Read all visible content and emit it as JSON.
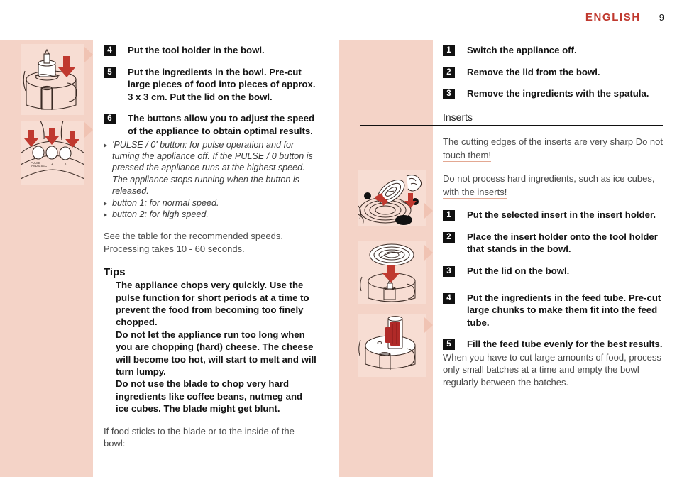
{
  "header": {
    "language": "ENGLISH",
    "page_number": "9"
  },
  "left_column": {
    "steps": [
      {
        "number": "4",
        "text": "Put the tool holder in the bowl."
      },
      {
        "number": "5",
        "text": "Put the ingredients in the bowl. Pre-cut large pieces of food into pieces of approx. 3 x 3 cm. Put the lid on the bowl."
      },
      {
        "number": "6",
        "text": "The buttons allow you to adjust the speed of the appliance to obtain optimal results."
      }
    ],
    "bullets": [
      "'PULSE / 0' button: for pulse operation and for turning the appliance off. If the PULSE / 0 button is pressed the appliance runs at the highest speed. The appliance stops running when the button is released.",
      "button 1: for normal speed.",
      "button 2: for high speed."
    ],
    "speeds_note": "See the table for the recommended speeds. Processing takes 10 - 60 seconds.",
    "tips_heading": "Tips",
    "tips": [
      "The appliance chops very quickly. Use the pulse function for short periods at a time to prevent the food from becoming too finely chopped.",
      "Do not let the appliance run too long when you are chopping (hard) cheese. The cheese will become too hot, will start to melt and will turn lumpy.",
      "Do not use the blade to chop very hard ingredients like coffee beans, nutmeg and ice cubes. The blade might get blunt."
    ],
    "closing_note": "If food sticks to the blade or to the inside of the bowl:"
  },
  "right_column": {
    "steps_top": [
      {
        "number": "1",
        "text": "Switch the appliance off."
      },
      {
        "number": "2",
        "text": "Remove the lid from the bowl."
      },
      {
        "number": "3",
        "text": "Remove the ingredients with the spatula."
      }
    ],
    "section_heading": "Inserts",
    "warnings": [
      "The cutting edges of the inserts are very sharp Do not touch them!",
      "Do not process hard ingredients, such as ice cubes, with the inserts!"
    ],
    "steps_bottom": [
      {
        "number": "1",
        "text": "Put the selected insert in the insert holder."
      },
      {
        "number": "2",
        "text": "Place the insert holder onto the tool holder that stands in the bowl."
      },
      {
        "number": "3",
        "text": "Put the lid on the bowl."
      },
      {
        "number": "4",
        "text": "Put the ingredients in the feed tube. Pre-cut large chunks to make them fit into the feed tube."
      },
      {
        "number": "5",
        "text": "Fill the feed tube evenly for the best results."
      }
    ],
    "closing_note": "When you have to cut large amounts of food, process only small batches at a time and empty the bowl regularly between the batches."
  },
  "illustrations": [
    {
      "name": "tool-holder-in-bowl"
    },
    {
      "name": "control-buttons-pulse-one-two"
    },
    {
      "name": "hand-holding-insert-warning"
    },
    {
      "name": "insert-holder-onto-tool-holder"
    },
    {
      "name": "feed-tube-filled-with-food"
    }
  ],
  "colors": {
    "accent_red": "#c0392f",
    "band_pink": "#f4d3c7",
    "illustration_pink": "#f7ddd3",
    "arrow_red": "#c0392f",
    "underline_salmon": "#e3a892"
  }
}
